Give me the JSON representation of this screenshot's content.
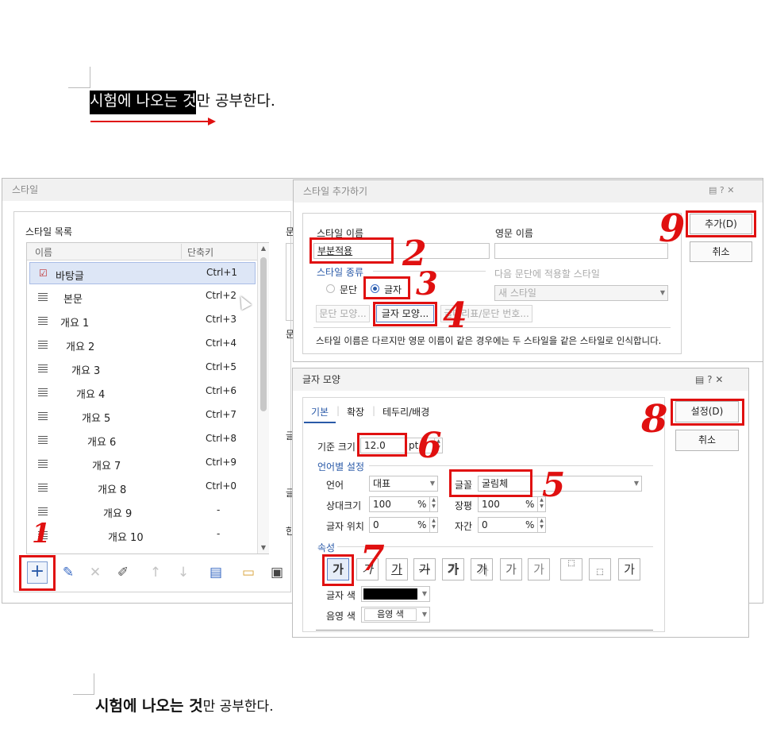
{
  "doc": {
    "line1_highlight": "시험에 나오는 것",
    "line1_rest": "만 공부한다.",
    "line2_bold": "시험에 나오는 것",
    "line2_rest": "만 공부한다."
  },
  "style_dialog": {
    "title": "스타일",
    "list_label": "스타일 목록",
    "col_name": "이름",
    "col_shortcut": "단축키",
    "items": [
      {
        "name": "바탕글",
        "shortcut": "Ctrl+1"
      },
      {
        "name": "본문",
        "shortcut": "Ctrl+2"
      },
      {
        "name": "개요 1",
        "shortcut": "Ctrl+3"
      },
      {
        "name": "개요 2",
        "shortcut": "Ctrl+4"
      },
      {
        "name": "개요 3",
        "shortcut": "Ctrl+5"
      },
      {
        "name": "개요 4",
        "shortcut": "Ctrl+6"
      },
      {
        "name": "개요 5",
        "shortcut": "Ctrl+7"
      },
      {
        "name": "개요 6",
        "shortcut": "Ctrl+8"
      },
      {
        "name": "개요 7",
        "shortcut": "Ctrl+9"
      },
      {
        "name": "개요 8",
        "shortcut": "Ctrl+0"
      },
      {
        "name": "개요 9",
        "shortcut": "-"
      },
      {
        "name": "개요 10",
        "shortcut": "-"
      }
    ],
    "side_labels": [
      "문",
      "문",
      "글",
      "글",
      "한"
    ]
  },
  "add_style": {
    "title": "스타일 추가하기",
    "name_label": "스타일 이름",
    "name_value": "부분적용",
    "eng_label": "영문 이름",
    "eng_value": "",
    "kind_label": "스타일 종류",
    "radio_para": "문단",
    "radio_char": "글자",
    "next_label": "다음 문단에 적용할 스타일",
    "next_value": "새 스타일",
    "btn_para_shape": "문단 모양...",
    "btn_char_shape": "글자 모양...",
    "btn_bullet": "글머리표/문단 번호...",
    "note": "스타일 이름은 다르지만 영문 이름이 같은 경우에는 두 스타일을 같은 스타일로 인식합니다.",
    "btn_add": "추가(D)",
    "btn_cancel": "취소"
  },
  "char_shape": {
    "title": "글자 모양",
    "tabs": [
      "기본",
      "확장",
      "테두리/배경"
    ],
    "base_size_label": "기준 크기",
    "base_size_value": "12.0",
    "base_size_unit": "pt",
    "lang_section": "언어별 설정",
    "lang_label": "언어",
    "lang_value": "대표",
    "font_label": "글꼴",
    "font_value": "굴림체",
    "rel_size_label": "상대크기",
    "rel_size_value": "100",
    "width_label": "장평",
    "width_value": "100",
    "pos_label": "글자 위치",
    "pos_value": "0",
    "spacing_label": "자간",
    "spacing_value": "0",
    "percent": "%",
    "attr_section": "속성",
    "attr_glyph": "가",
    "color_label": "글자 색",
    "shade_label": "음영 색",
    "shade_value": "음영 색",
    "text_color": "#000000",
    "btn_set": "설정(D)",
    "btn_cancel": "취소"
  },
  "annotations": [
    "1",
    "2",
    "3",
    "4",
    "5",
    "6",
    "7",
    "8",
    "9"
  ]
}
